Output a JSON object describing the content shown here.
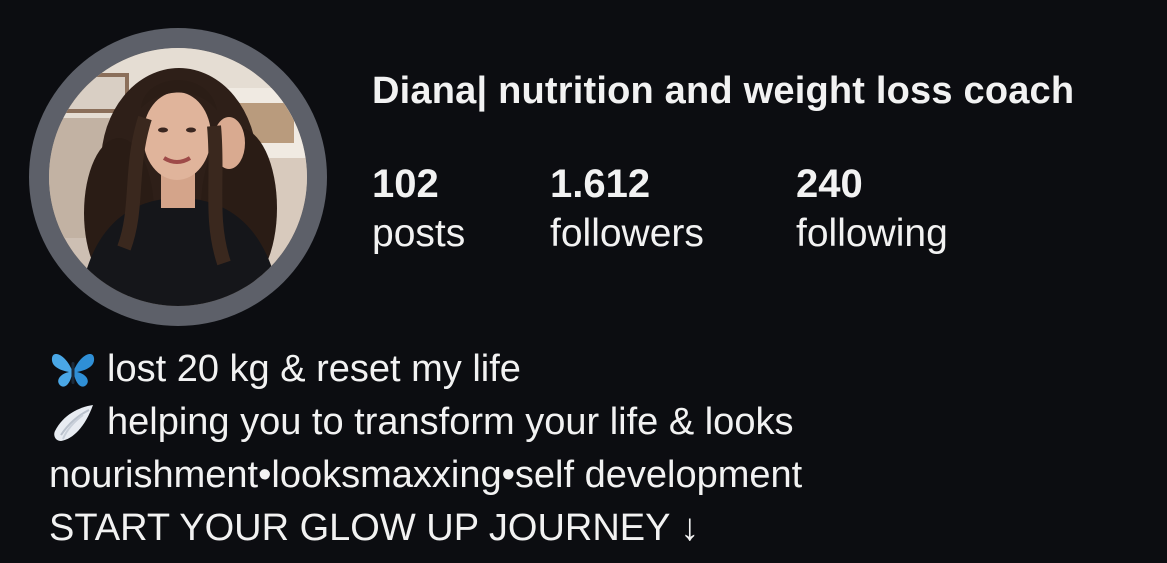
{
  "profile": {
    "display_name": "Diana| nutrition and weight loss coach",
    "avatar_icon": "profile-photo"
  },
  "stats": {
    "posts": {
      "count": "102",
      "label": "posts"
    },
    "followers": {
      "count": "1.612",
      "label": "followers"
    },
    "following": {
      "count": "240",
      "label": "following"
    }
  },
  "bio": {
    "line1_emoji": "butterfly-icon",
    "line1_text": "lost 20 kg & reset my life",
    "line2_emoji": "wing-icon",
    "line2_text": "helping you to transform your life & looks",
    "line3_text": "nourishment•looksmaxxing•self development",
    "line4_text": "START YOUR GLOW UP JOURNEY ↓"
  },
  "colors": {
    "background": "#0c0d11",
    "text": "#f2f2f2",
    "avatar_ring": "#5d6069",
    "butterfly": "#4aa7e6"
  }
}
